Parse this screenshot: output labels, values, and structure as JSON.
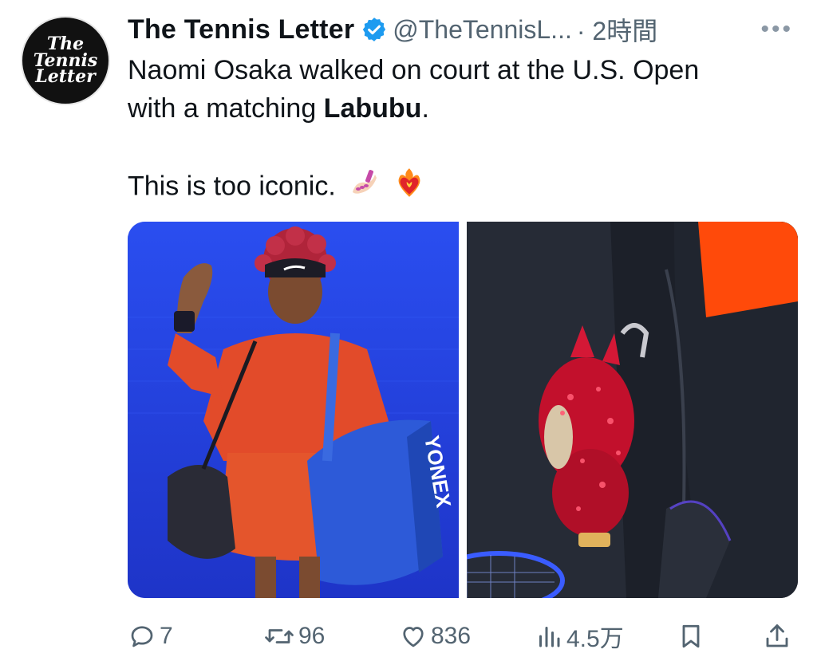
{
  "tweet": {
    "display_name": "The Tennis Letter",
    "handle": "@TheTennisL...",
    "time": "· 2時間",
    "more": "•••",
    "line1": "Naomi Osaka walked on court at the U.S. Open",
    "line2_prefix": "with a matching ",
    "line2_bold": "Labubu",
    "line2_suffix": ".",
    "line3": "This is too iconic.",
    "emojis": [
      "nail-polish-emoji",
      "heart-on-fire-emoji"
    ]
  },
  "avatar": {
    "line1": "The",
    "line2": "Tennis",
    "line3": "Letter"
  },
  "photos": {
    "left_bag_text": "YONEX"
  },
  "actions": {
    "replies": "7",
    "retweets": "96",
    "likes": "836",
    "views": "4.5万"
  },
  "colors": {
    "accent": "#1d9bf0",
    "muted": "#536471"
  }
}
